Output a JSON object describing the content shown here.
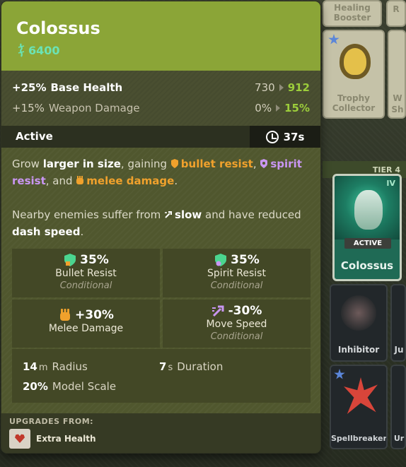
{
  "item": {
    "name": "Colossus",
    "cost": "6400"
  },
  "stats": [
    {
      "pct": "+25%",
      "label": "Base Health",
      "from": "730",
      "to": "912"
    },
    {
      "pct": "+15%",
      "label": "Weapon Damage",
      "from": "0%",
      "to": "15%"
    }
  ],
  "active": {
    "label": "Active",
    "cooldown": "37s"
  },
  "description": {
    "line1_a": "Grow ",
    "line1_b": "larger in size",
    "line1_c": ", gaining ",
    "kw_bullet": "bullet resist",
    "sep1": ",",
    "kw_spirit": "spirit resist",
    "sep2": ", and ",
    "kw_melee": "melee damage",
    "end1": ".",
    "line2_a": "Nearby enemies suffer from ",
    "kw_slow": "slow",
    "line2_b": " and have reduced ",
    "kw_dash": "dash speed",
    "end2": "."
  },
  "effects": [
    {
      "value": "35%",
      "name": "Bullet Resist",
      "cond": "Conditional",
      "icon": "bullet-resist-icon",
      "color": "#4bd58f"
    },
    {
      "value": "35%",
      "name": "Spirit Resist",
      "cond": "Conditional",
      "icon": "spirit-resist-icon",
      "color": "#4bd58f"
    },
    {
      "value": "+30%",
      "name": "Melee Damage",
      "cond": "",
      "icon": "melee-damage-icon",
      "color": "#f0a12c"
    },
    {
      "value": "-30%",
      "name": "Move Speed",
      "cond": "Conditional",
      "icon": "move-speed-icon",
      "color": "#c996f2"
    }
  ],
  "extra": {
    "radius_value": "14",
    "radius_unit": "m",
    "radius_label": "Radius",
    "duration_value": "7",
    "duration_unit": "s",
    "duration_label": "Duration",
    "scale_value": "20%",
    "scale_label": "Model Scale"
  },
  "upgrades": {
    "header": "UPGRADES FROM:",
    "item_name": "Extra Health"
  },
  "background": {
    "card_healing": "Healing Booster",
    "card_trophy": "Trophy Collector",
    "card_r": "R",
    "card_w": "W",
    "card_sh": "Sh",
    "tier_label": "TIER 4",
    "active_badge": "ACTIVE",
    "active_card_name": "Colossus",
    "active_card_tier": "IV",
    "card_inhibitor": "Inhibitor",
    "card_spellbreaker": "Spellbreaker",
    "card_ju": "Ju",
    "card_ur": "Ur"
  },
  "colors": {
    "header_green": "#8ba537",
    "cost_teal": "#6be3b5",
    "upgrade_green": "#9ccd3b",
    "keyword_orange": "#f0a12c",
    "keyword_purple": "#c996f2"
  }
}
